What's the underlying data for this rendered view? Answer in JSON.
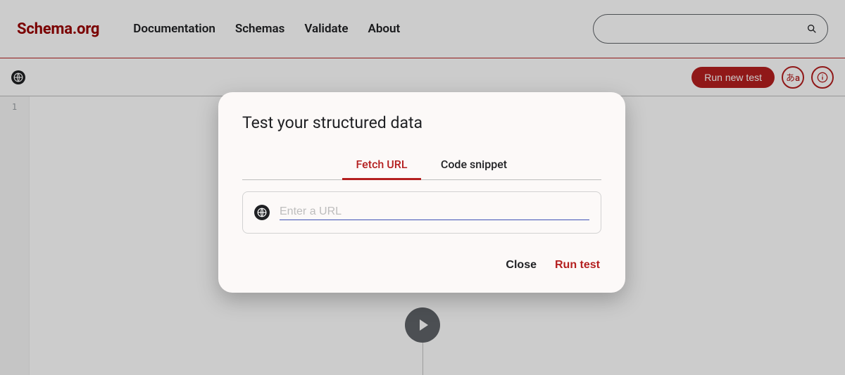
{
  "header": {
    "logo": "Schema.org",
    "nav": [
      "Documentation",
      "Schemas",
      "Validate",
      "About"
    ],
    "search_placeholder": ""
  },
  "toolbar": {
    "run_new_label": "Run new test",
    "lang_glyph": "あa"
  },
  "editor": {
    "line_number": "1"
  },
  "modal": {
    "title": "Test your structured data",
    "tabs": {
      "fetch": "Fetch URL",
      "snippet": "Code snippet"
    },
    "url_placeholder": "Enter a URL",
    "url_value": "",
    "close_label": "Close",
    "run_label": "Run test"
  }
}
